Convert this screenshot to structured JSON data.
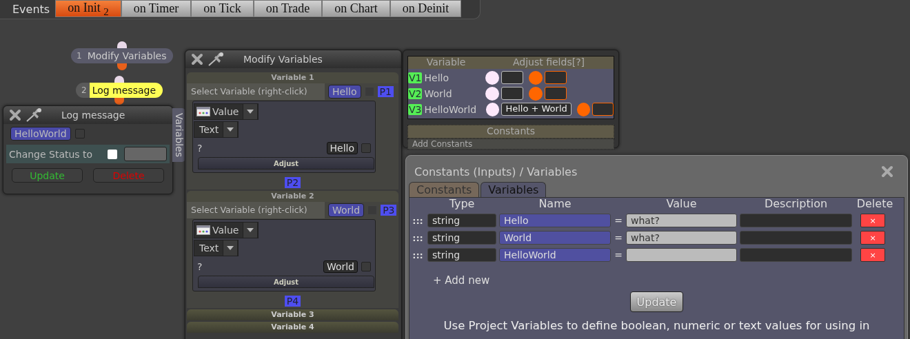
{
  "events": {
    "label": "Events",
    "tabs": [
      {
        "label": "on Init $_{2}$",
        "selected": true
      },
      {
        "label": "on Timer",
        "selected": false
      },
      {
        "label": "on Tick",
        "selected": false
      },
      {
        "label": "on Trade",
        "selected": false
      },
      {
        "label": "on Chart",
        "selected": false
      },
      {
        "label": "on Deinit",
        "selected": false
      }
    ]
  },
  "flow_nodes": [
    {
      "number": "1",
      "label": "Modify Variables",
      "selected": false
    },
    {
      "number": "2",
      "label": "Log message",
      "selected": true
    }
  ],
  "log_window": {
    "title": "Log message",
    "variable": "HelloWorld",
    "variable_checked": false,
    "status_label": "Change Status to",
    "status_checked": false,
    "side_tab": "Variables",
    "buttons": [
      {
        "label": "Update",
        "kind": "update"
      },
      {
        "label": "Delete",
        "kind": "delete"
      }
    ]
  },
  "modify_window": {
    "title": "Modify Variables",
    "sections": [
      {
        "header": "Variable 1",
        "expanded": true,
        "select_label": "Select Variable (right-click)",
        "variable": "Hello",
        "variable_checked": false,
        "pin_top": "P1",
        "source": "Value",
        "format": "Text",
        "prompt": "?",
        "value": "Hello",
        "checked": false,
        "adjust": "Adjust",
        "pin_bottom": "P2"
      },
      {
        "header": "Variable 2",
        "expanded": true,
        "select_label": "Select Variable (right-click)",
        "variable": "World",
        "variable_checked": false,
        "pin_top": "P3",
        "source": "Value",
        "format": "Text",
        "prompt": "?",
        "value": "World",
        "checked": false,
        "adjust": "Adjust",
        "pin_bottom": "P4"
      },
      {
        "header": "Variable 3",
        "expanded": false
      },
      {
        "header": "Variable 4",
        "expanded": false
      }
    ]
  },
  "variables_panel": {
    "columns": [
      "Variable",
      "Adjust fields[?]"
    ],
    "rows": [
      {
        "badge": "V1",
        "name": "Hello"
      },
      {
        "badge": "V2",
        "name": "World"
      },
      {
        "badge": "V3",
        "name": "HelloWorld",
        "adjust_value": "Hello + World"
      }
    ],
    "constants_header": "Constants",
    "constants_action": "Add Constants"
  },
  "dialog": {
    "title": "Constants (Inputs) / Variables",
    "tabs": [
      {
        "label": "Constants",
        "selected": false
      },
      {
        "label": "Variables",
        "selected": true
      }
    ],
    "columns": [
      "Type",
      "Name",
      "Value",
      "Description",
      "Delete"
    ],
    "rows": [
      {
        "handle": ":::",
        "type": "string",
        "equals": "=",
        "name": "Hello",
        "value": "what?",
        "delete": "×"
      },
      {
        "handle": ":::",
        "type": "string",
        "equals": "=",
        "name": "World",
        "value": "what?",
        "delete": "×"
      },
      {
        "handle": ":::",
        "type": "string",
        "equals": "=",
        "name": "HelloWorld",
        "delete": "×"
      }
    ],
    "add_new": "+ Add new",
    "update": "Update",
    "help": "Use Project Variables to define boolean, numeric or text values for using in"
  }
}
